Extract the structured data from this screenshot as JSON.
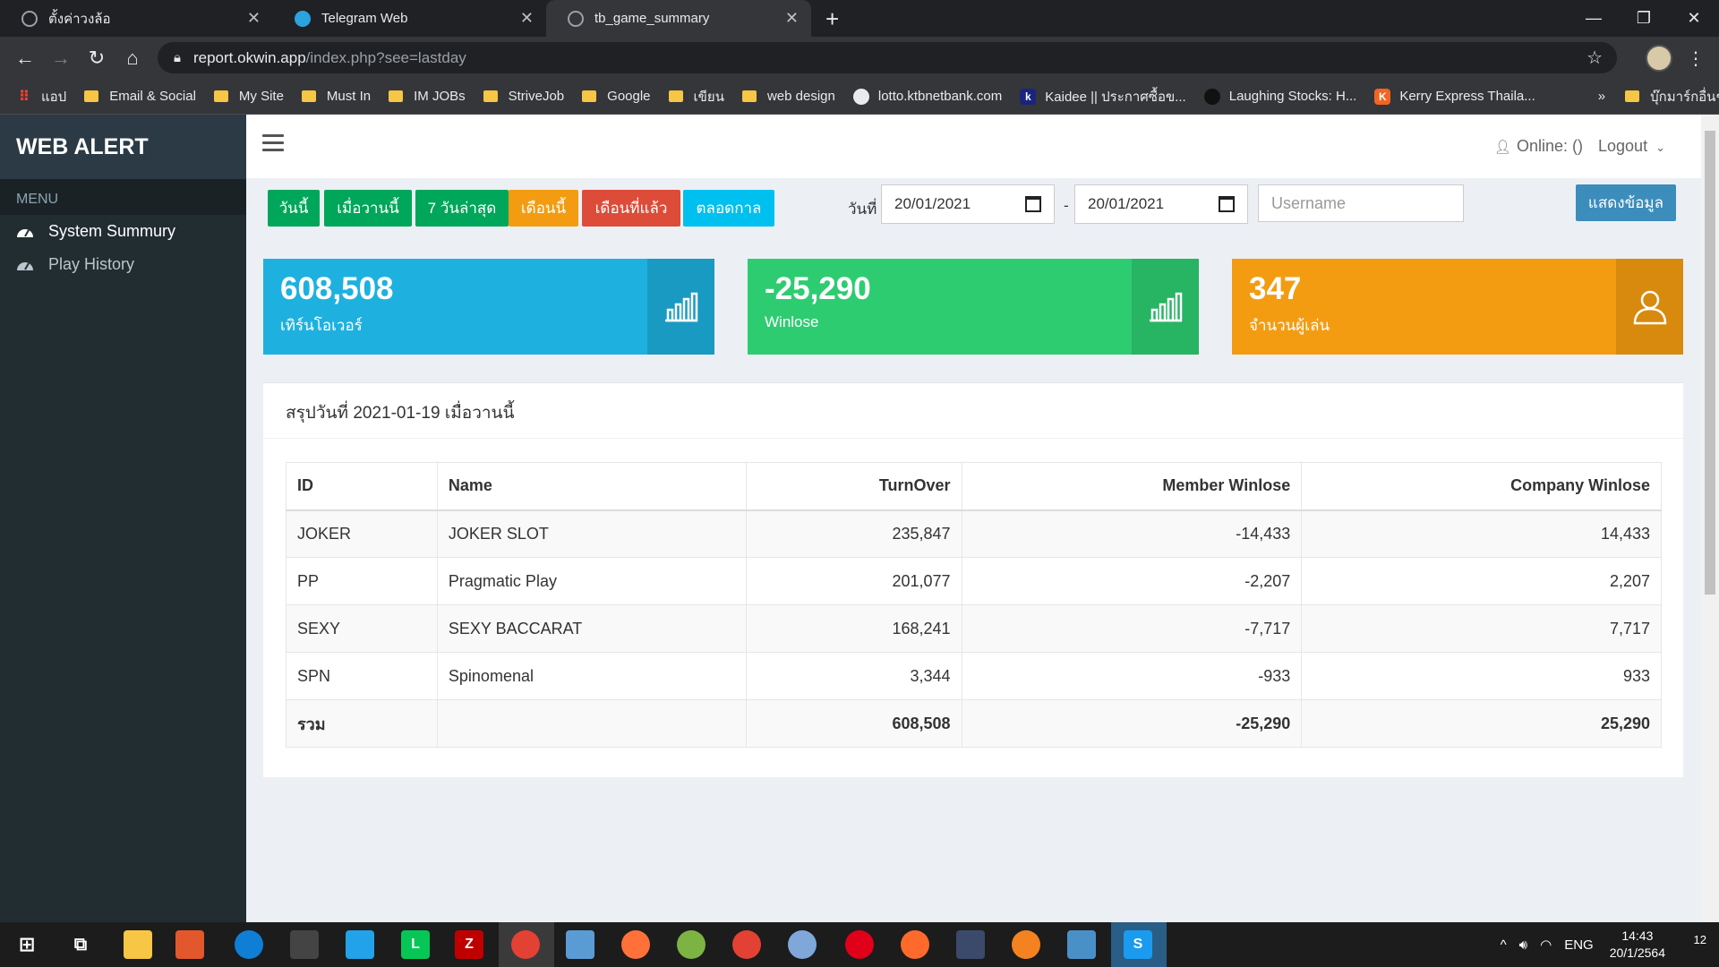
{
  "browser": {
    "tabs": [
      {
        "label": "ตั้งค่าวงล้อ",
        "favicon_color": "#9aa0a6"
      },
      {
        "label": "Telegram Web",
        "favicon_color": "#2aa3df"
      },
      {
        "label": "tb_game_summary",
        "favicon_color": "#9aa0a6"
      }
    ],
    "url_host": "report.okwin.app",
    "url_path": "/index.php?see=lastday",
    "bookmarks": [
      {
        "label": "แอป",
        "icon": "apps-grid-icon"
      },
      {
        "label": "Email & Social",
        "icon": "folder-icon"
      },
      {
        "label": "My Site",
        "icon": "folder-icon"
      },
      {
        "label": "Must In",
        "icon": "folder-icon"
      },
      {
        "label": "IM JOBs",
        "icon": "folder-icon"
      },
      {
        "label": "StriveJob",
        "icon": "folder-icon"
      },
      {
        "label": "Google",
        "icon": "folder-icon"
      },
      {
        "label": "เขียน",
        "icon": "folder-icon"
      },
      {
        "label": "web design",
        "icon": "folder-icon"
      },
      {
        "label": "lotto.ktbnetbank.com",
        "icon": "globe-icon"
      },
      {
        "label": "Kaidee || ประกาศซื้อข...",
        "icon": "kaidee-icon"
      },
      {
        "label": "Laughing Stocks: H...",
        "icon": "laughing-stocks-icon"
      },
      {
        "label": "Kerry Express Thaila...",
        "icon": "kerry-icon"
      }
    ],
    "bookmarks_more": "»",
    "bookmarks_other": "บุ๊กมาร์กอื่นๆ"
  },
  "app": {
    "logo": "WEB ALERT",
    "menu_header": "MENU",
    "menu": [
      {
        "label": "System Summury",
        "icon": "dashboard-icon",
        "active": true
      },
      {
        "label": "Play History",
        "icon": "dashboard-icon",
        "active": false
      }
    ],
    "online": "Online: ()",
    "logout": "Logout",
    "filters": [
      {
        "label": "วันนี้",
        "color": "#00a65a"
      },
      {
        "label": "เมื่อวานนี้",
        "color": "#00a65a"
      },
      {
        "label": "7 วันล่าสุด",
        "color": "#00a65a"
      },
      {
        "label": "เดือนนี้",
        "color": "#f39c12"
      },
      {
        "label": "เดือนที่แล้ว",
        "color": "#dd4b39"
      },
      {
        "label": "ตลอดกาล",
        "color": "#00c0ef"
      }
    ],
    "date_label": "วันที่",
    "date_from": "20/01/2021",
    "date_sep": "-",
    "date_to": "20/01/2021",
    "username_placeholder": "Username",
    "show_button": "แสดงข้อมูล",
    "stats": [
      {
        "value": "608,508",
        "label": "เทิร์นโอเวอร์",
        "color": "#1eb1e0",
        "icon_bg": "#199ac2",
        "icon": "bar-chart-icon"
      },
      {
        "value": "-25,290",
        "label": "Winlose",
        "color": "#2ecc71",
        "icon_bg": "#27b463",
        "icon": "bar-chart-icon"
      },
      {
        "value": "347",
        "label": "จำนวนผู้เล่น",
        "color": "#f39c12",
        "icon_bg": "#d88a0f",
        "icon": "user-icon"
      }
    ],
    "summary_title": "สรุปวันที่ 2021-01-19 เมื่อวานนี้",
    "table": {
      "headers": [
        "ID",
        "Name",
        "TurnOver",
        "Member Winlose",
        "Company Winlose"
      ],
      "rows": [
        [
          "JOKER",
          "JOKER SLOT",
          "235,847",
          "-14,433",
          "14,433"
        ],
        [
          "PP",
          "Pragmatic Play",
          "201,077",
          "-2,207",
          "2,207"
        ],
        [
          "SEXY",
          "SEXY BACCARAT",
          "168,241",
          "-7,717",
          "7,717"
        ],
        [
          "SPN",
          "Spinomenal",
          "3,344",
          "-933",
          "933"
        ]
      ],
      "footer": [
        "รวม",
        "",
        "608,508",
        "-25,290",
        "25,290"
      ]
    }
  },
  "taskbar": {
    "lang": "ENG",
    "time": "14:43",
    "date": "20/1/2564",
    "notifications": "12"
  }
}
